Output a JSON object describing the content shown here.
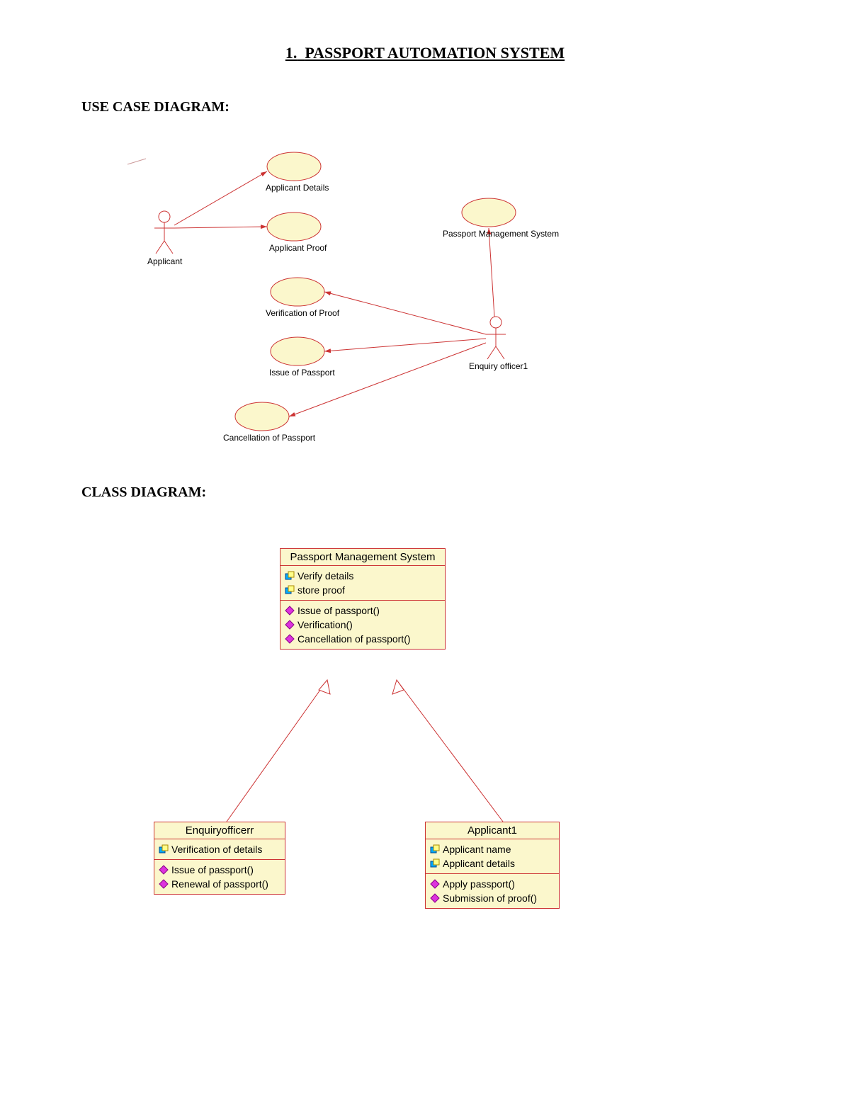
{
  "doc": {
    "number": "1.",
    "title": "PASSPORT AUTOMATION SYSTEM",
    "h_usecase": "USE CASE DIAGRAM:",
    "h_class": "CLASS DIAGRAM:"
  },
  "usecase": {
    "actors": {
      "applicant": "Applicant",
      "officer": "Enquiry officer1"
    },
    "cases": {
      "details": "Applicant Details",
      "proof": "Applicant Proof",
      "verify": "Verification of Proof",
      "issue": "Issue of Passport",
      "cancel": "Cancellation of Passport",
      "pms": "Passport Management System"
    }
  },
  "classdiag": {
    "pms": {
      "name": "Passport Management System",
      "attrs": [
        "Verify details",
        "store proof"
      ],
      "ops": [
        "Issue of passport()",
        "Verification()",
        "Cancellation of passport()"
      ]
    },
    "officer": {
      "name": "Enquiryofficerr",
      "attrs": [
        "Verification of details"
      ],
      "ops": [
        "Issue of passport()",
        "Renewal of passport()"
      ]
    },
    "applicant": {
      "name": "Applicant1",
      "attrs": [
        "Applicant name",
        "Applicant details"
      ],
      "ops": [
        "Apply passport()",
        "Submission of proof()"
      ]
    }
  }
}
